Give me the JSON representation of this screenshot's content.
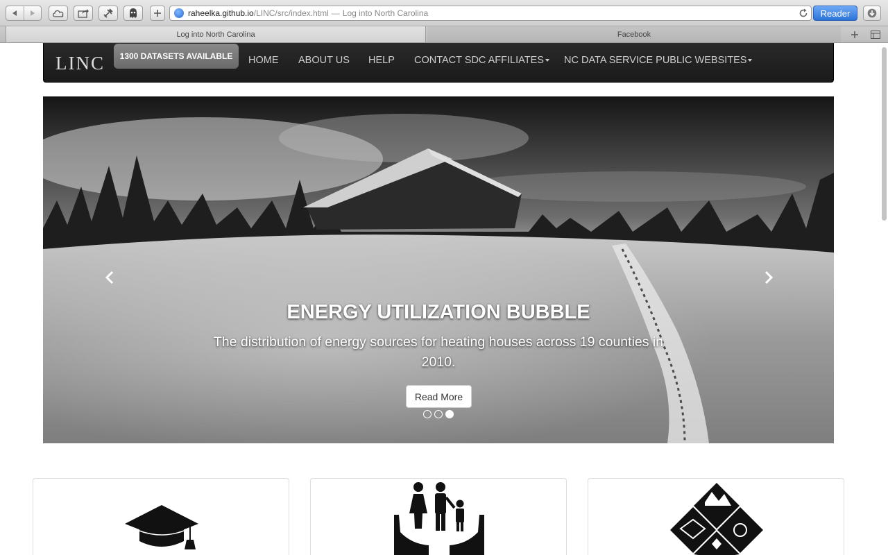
{
  "browser": {
    "url_host": "raheelka.github.io",
    "url_path": "/LINC/src/index.html",
    "url_separator": "—",
    "url_title": "Log into North Carolina",
    "reader_label": "Reader",
    "tabs": [
      {
        "label": "Log into North Carolina"
      },
      {
        "label": "Facebook"
      }
    ],
    "icons": [
      "back-icon",
      "forward-icon",
      "icloud-icon",
      "share-icon",
      "extension-icon",
      "ghostery-icon",
      "add-icon",
      "reload-icon",
      "download-icon",
      "new-tab-icon",
      "tab-list-icon"
    ]
  },
  "site": {
    "brand": "LINC",
    "datasets_badge": "1300 DATASETS AVAILABLE",
    "nav": [
      {
        "label": "HOME"
      },
      {
        "label": "ABOUT US"
      },
      {
        "label": "HELP"
      },
      {
        "label": "CONTACT SDC AFFILIATES"
      },
      {
        "label": "NC DATA SERVICE PUBLIC WEBSITES"
      }
    ]
  },
  "carousel": {
    "title": "ENERGY UTILIZATION BUBBLE",
    "text": "The distribution of energy sources for heating houses across 19 counties in 2010.",
    "button_label": "Read More",
    "slide_count": 3,
    "active_slide": 3
  },
  "cards": [
    {
      "icon": "graduation-cap-icon"
    },
    {
      "icon": "family-hands-icon"
    },
    {
      "icon": "nature-tiles-icon"
    }
  ],
  "colors": {
    "navbar": "#1f1f1f",
    "reader_button": "#3a80e0",
    "badge": "#7a7a7a"
  }
}
